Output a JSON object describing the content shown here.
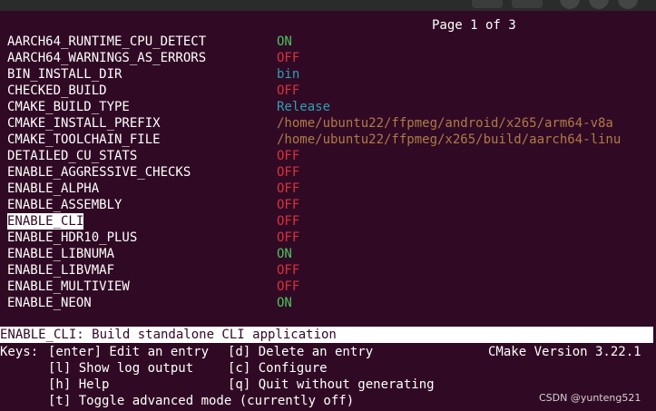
{
  "pager": "Page 1 of 3",
  "entries": [
    {
      "key": "AARCH64_RUNTIME_CPU_DETECT",
      "value": "ON"
    },
    {
      "key": "AARCH64_WARNINGS_AS_ERRORS",
      "value": "OFF"
    },
    {
      "key": "BIN_INSTALL_DIR",
      "value": "bin"
    },
    {
      "key": "CHECKED_BUILD",
      "value": "OFF"
    },
    {
      "key": "CMAKE_BUILD_TYPE",
      "value": "Release"
    },
    {
      "key": "CMAKE_INSTALL_PREFIX",
      "value": "/home/ubuntu22/ffpmeg/android/x265/arm64-v8a"
    },
    {
      "key": "CMAKE_TOOLCHAIN_FILE",
      "value": "/home/ubuntu22/ffpmeg/x265/build/aarch64-linu"
    },
    {
      "key": "DETAILED_CU_STATS",
      "value": "OFF"
    },
    {
      "key": "ENABLE_AGGRESSIVE_CHECKS",
      "value": "OFF"
    },
    {
      "key": "ENABLE_ALPHA",
      "value": "OFF"
    },
    {
      "key": "ENABLE_ASSEMBLY",
      "value": "OFF"
    },
    {
      "key": "ENABLE_CLI",
      "value": "OFF"
    },
    {
      "key": "ENABLE_HDR10_PLUS",
      "value": "OFF"
    },
    {
      "key": "ENABLE_LIBNUMA",
      "value": "ON"
    },
    {
      "key": "ENABLE_LIBVMAF",
      "value": "OFF"
    },
    {
      "key": "ENABLE_MULTIVIEW",
      "value": "OFF"
    },
    {
      "key": "ENABLE_NEON",
      "value": "ON"
    }
  ],
  "selected_index": 11,
  "description": "ENABLE_CLI: Build standalone CLI application",
  "footer": {
    "keys_label": "Keys:",
    "enter": "[enter] Edit an entry",
    "delete": "[d] Delete an entry",
    "version": "CMake Version 3.22.1",
    "log": "[l] Show log output",
    "configure": "[c] Configure",
    "help": "[h] Help",
    "quit": "[q] Quit without generating",
    "toggle": "[t] Toggle advanced mode (currently off)"
  },
  "watermark": "CSDN @yunteng521",
  "colors": {
    "background": "#300a24",
    "on": "#4cc160",
    "off": "#d9313c",
    "plain_value": "#2f9fb2",
    "path_value": "#b07a46",
    "selection_bg": "#ffffff"
  }
}
